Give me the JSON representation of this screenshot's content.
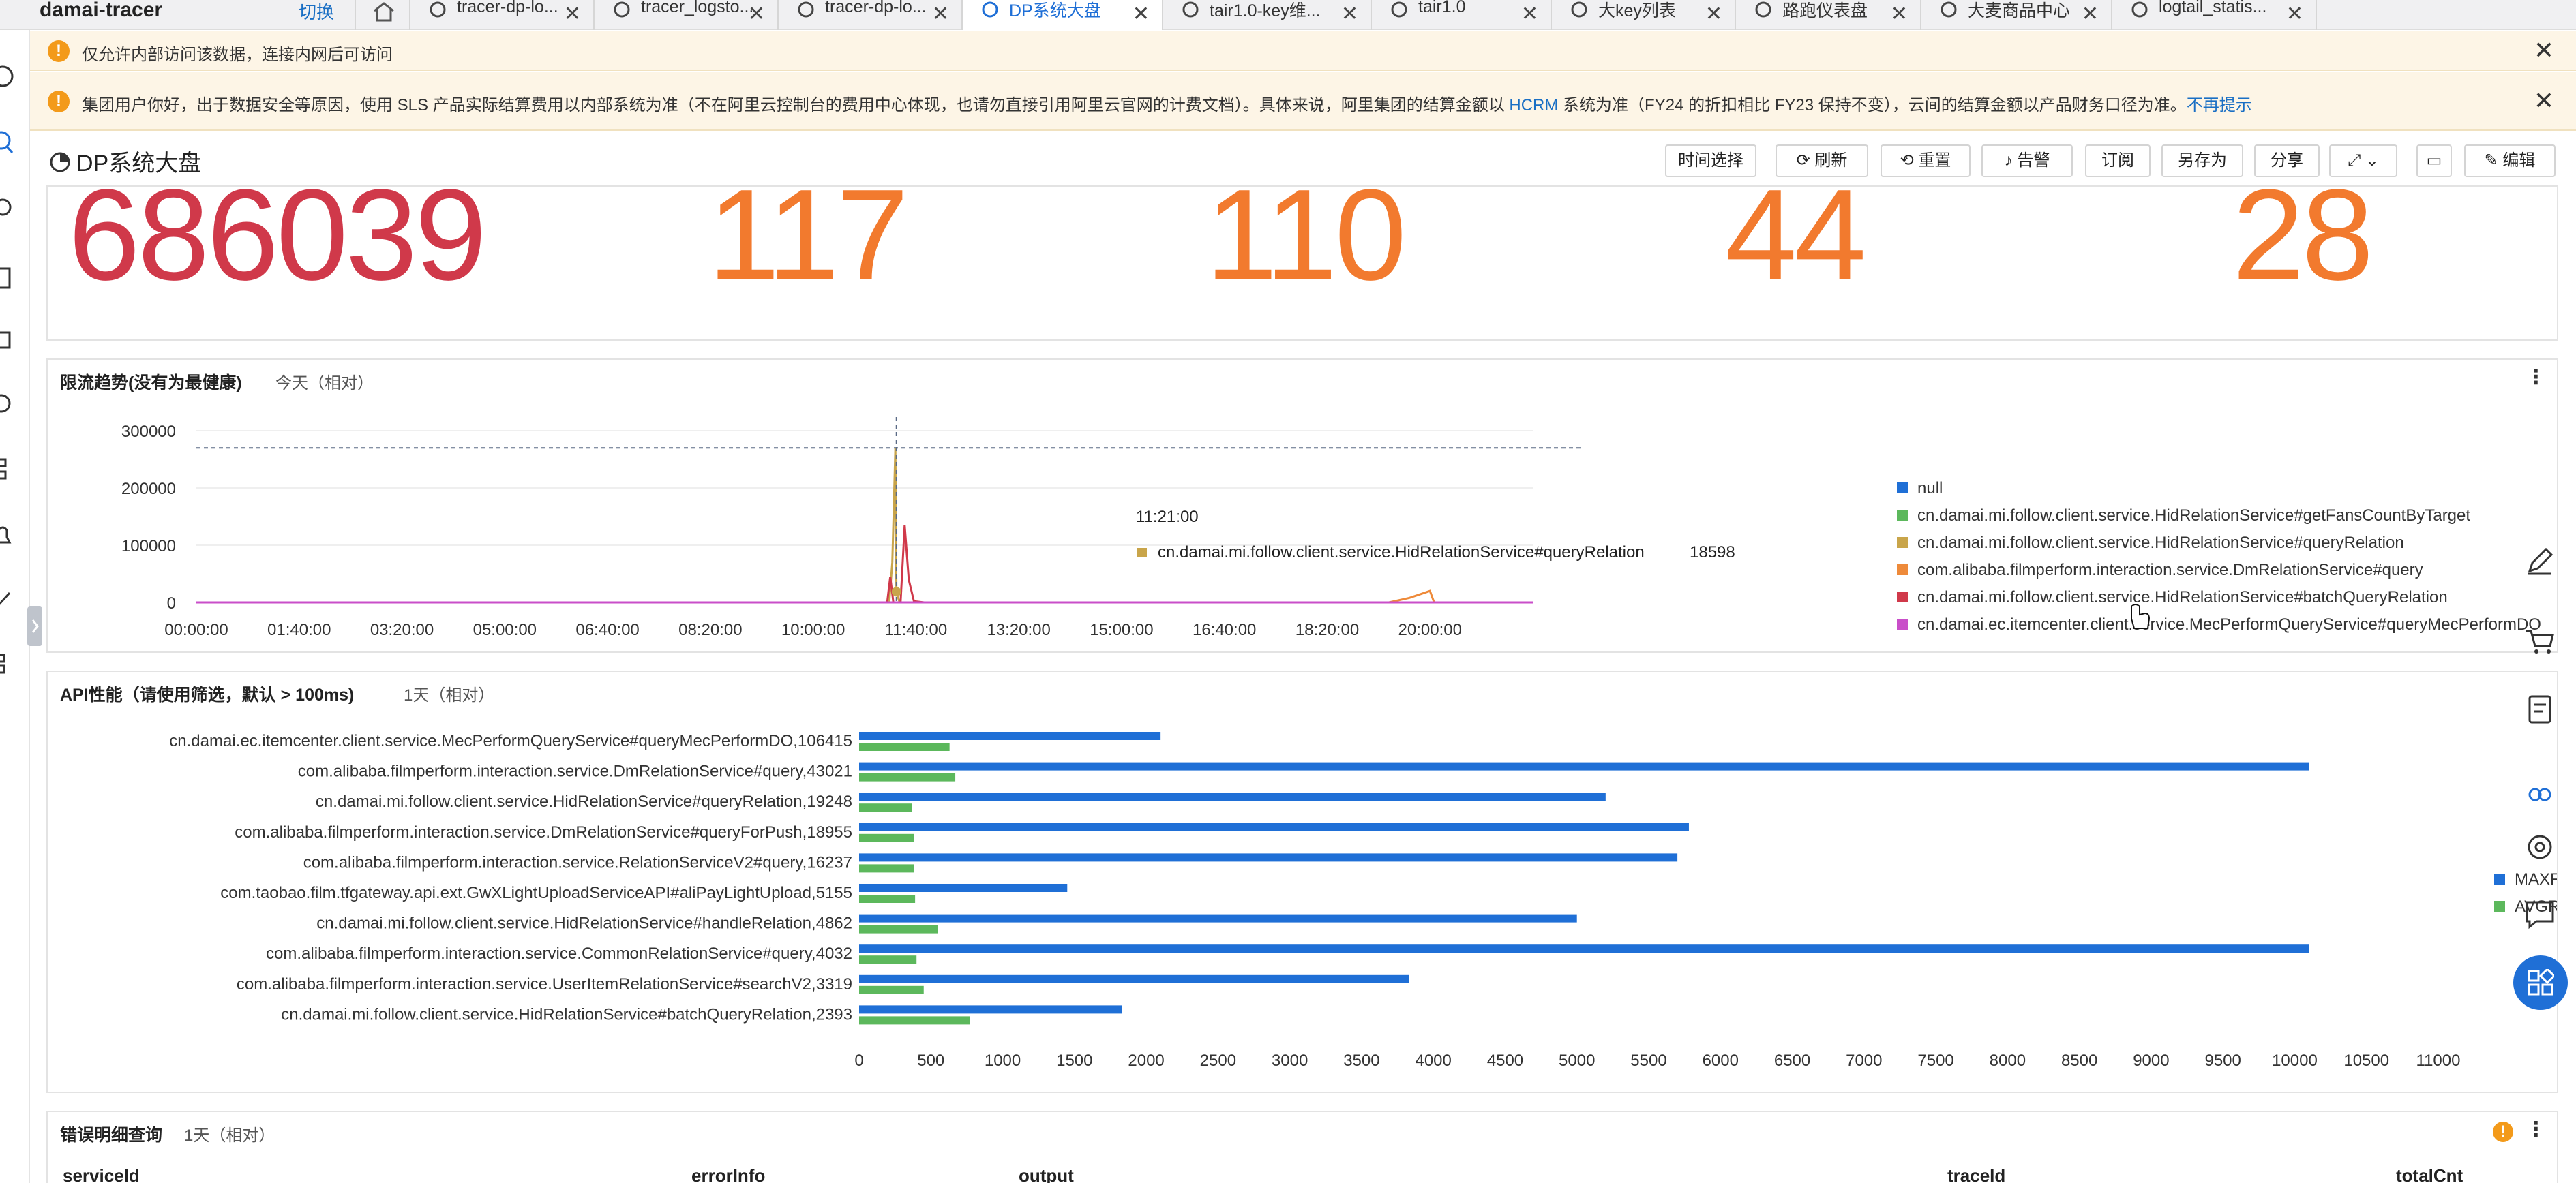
{
  "project": {
    "name": "damai-tracer",
    "switch_label": "切换"
  },
  "tabs": [
    {
      "label": "tracer-dp-lo...",
      "icon": "search-chart-icon"
    },
    {
      "label": "tracer_logsto...",
      "icon": "search-chart-icon"
    },
    {
      "label": "tracer-dp-lo...",
      "icon": "target-icon"
    },
    {
      "label": "DP系统大盘",
      "icon": "dashboard-icon",
      "active": true
    },
    {
      "label": "tair1.0-key维...",
      "icon": "dashboard-icon"
    },
    {
      "label": "tair1.0",
      "icon": "dashboard-icon"
    },
    {
      "label": "大key列表",
      "icon": "dashboard-icon"
    },
    {
      "label": "路跑仪表盘",
      "icon": "dashboard-icon"
    },
    {
      "label": "大麦商品中心",
      "icon": "dashboard-icon"
    },
    {
      "label": "logtail_statis...",
      "icon": "dashboard-icon"
    }
  ],
  "tab_close": "✕",
  "banners": {
    "internal": {
      "text": "仅允许内部访问该数据，连接内网后可访问"
    },
    "billing": {
      "text_a": "集团用户你好，出于数据安全等原因，使用 SLS 产品实际结算费用以内部系统为准（不在阿里云控制台的费用中心体现，也请勿直接引用阿里云官网的计费文档）。具体来说，阿里集团的结算金额以 ",
      "link_hcrm": "HCRM",
      "text_b": " 系统为准（FY24 的折扣相比 FY23 保持不变），云间的结算金额以产品财务口径为准。",
      "dismiss": "不再提示"
    }
  },
  "dashboard": {
    "title": "DP系统大盘"
  },
  "toolbar": {
    "time": "时间选择",
    "refresh": "刷新",
    "reset": "重置",
    "alert": "告警",
    "subscribe": "订阅",
    "save_as": "另存为",
    "share": "分享",
    "edit": "编辑"
  },
  "big_numbers": [
    "686039",
    "117",
    "110",
    "44",
    "28"
  ],
  "colors": {
    "red": "#d0394a",
    "orange": "#f27a2e",
    "blue": "#1f6fd6"
  },
  "panel_limit": {
    "title": "限流趋势(没有为最健康)",
    "range": "今天（相对）",
    "tooltip": {
      "time": "11:21:00",
      "series": "cn.damai.mi.follow.client.service.HidRelationService#queryRelation",
      "value": "18598"
    }
  },
  "panel_api": {
    "title": "API性能（请使用筛选，默认 > 100ms)",
    "range": "1天（相对）"
  },
  "panel_err": {
    "title": "错误明细查询",
    "range": "1天（相对）",
    "columns": [
      "serviceId",
      "errorInfo",
      "output",
      "traceId",
      "totalCnt"
    ]
  },
  "chart_data": [
    {
      "type": "line",
      "title": "限流趋势(没有为最健康)",
      "x_ticks": [
        "00:00:00",
        "01:40:00",
        "03:20:00",
        "05:00:00",
        "06:40:00",
        "08:20:00",
        "10:00:00",
        "11:40:00",
        "13:20:00",
        "15:00:00",
        "16:40:00",
        "18:20:00",
        "20:00:00"
      ],
      "y_ticks": [
        "0",
        "100000",
        "200000",
        "300000"
      ],
      "ylim": [
        0,
        300000
      ],
      "legend_position": "right",
      "series": [
        {
          "name": "null",
          "color": "#1f6fd6",
          "points": [
            [
              "00:00:00",
              0
            ],
            [
              "21:40:00",
              0
            ]
          ]
        },
        {
          "name": "cn.damai.mi.follow.client.service.HidRelationService#getFansCountByTarget",
          "color": "#5cb85c",
          "points": [
            [
              "00:00:00",
              0
            ],
            [
              "21:40:00",
              0
            ]
          ]
        },
        {
          "name": "cn.damai.mi.follow.client.service.HidRelationService#queryRelation",
          "color": "#c9a54a",
          "points": [
            [
              "11:00:00",
              0
            ],
            [
              "11:14:00",
              0
            ],
            [
              "11:17:00",
              70000
            ],
            [
              "11:20:00",
              270000
            ],
            [
              "11:21:00",
              18598
            ],
            [
              "11:24:00",
              0
            ],
            [
              "11:40:00",
              0
            ]
          ]
        },
        {
          "name": "com.alibaba.filmperform.interaction.service.DmRelationService#query",
          "color": "#ee8a3a",
          "points": [
            [
              "19:20:00",
              0
            ],
            [
              "19:40:00",
              8000
            ],
            [
              "20:00:00",
              20000
            ],
            [
              "20:04:00",
              0
            ]
          ]
        },
        {
          "name": "cn.damai.mi.follow.client.service.HidRelationService#batchQueryRelation",
          "color": "#d0394a",
          "points": [
            [
              "11:12:00",
              0
            ],
            [
              "11:15:00",
              45000
            ],
            [
              "11:18:00",
              0
            ],
            [
              "11:25:00",
              0
            ],
            [
              "11:29:00",
              135000
            ],
            [
              "11:33:00",
              40000
            ],
            [
              "11:38:00",
              2000
            ],
            [
              "11:48:00",
              0
            ]
          ]
        },
        {
          "name": "cn.damai.ec.itemcenter.client.service.MecPerformQueryService#queryMecPerformDO",
          "color": "#c94ec9",
          "points": [
            [
              "00:00:00",
              0
            ],
            [
              "21:40:00",
              0
            ]
          ]
        }
      ],
      "reference_line": 270000
    },
    {
      "type": "bar",
      "orientation": "horizontal",
      "title": "API性能（请使用筛选，默认 > 100ms)",
      "categories": [
        "cn.damai.ec.itemcenter.client.service.MecPerformQueryService#queryMecPerformDO,106415",
        "com.alibaba.filmperform.interaction.service.DmRelationService#query,43021",
        "cn.damai.mi.follow.client.service.HidRelationService#queryRelation,19248",
        "com.alibaba.filmperform.interaction.service.DmRelationService#queryForPush,18955",
        "com.alibaba.filmperform.interaction.service.RelationServiceV2#query,16237",
        "com.taobao.film.tfgateway.api.ext.GwXLightUploadServiceAPI#aliPayLightUpload,5155",
        "cn.damai.mi.follow.client.service.HidRelationService#handleRelation,4862",
        "com.alibaba.filmperform.interaction.service.CommonRelationService#query,4032",
        "com.alibaba.filmperform.interaction.service.UserItemRelationService#searchV2,3319",
        "cn.damai.mi.follow.client.service.HidRelationService#batchQueryRelation,2393"
      ],
      "series": [
        {
          "name": "MAXRT",
          "color": "#1f6fd6",
          "values": [
            2100,
            10100,
            5200,
            5780,
            5700,
            1450,
            5000,
            10100,
            3830,
            1830
          ]
        },
        {
          "name": "AVGRT",
          "color": "#5cb85c",
          "values": [
            630,
            670,
            370,
            380,
            380,
            390,
            550,
            400,
            450,
            770
          ]
        }
      ],
      "x_ticks": [
        0,
        500,
        1000,
        1500,
        2000,
        2500,
        3000,
        3500,
        4000,
        4500,
        5000,
        5500,
        6000,
        6500,
        7000,
        7500,
        8000,
        8500,
        9000,
        9500,
        10000,
        10500,
        11000
      ],
      "xlim": [
        0,
        11000
      ],
      "legend_position": "right",
      "legend_labels": [
        "MAXRT",
        "AVGR"
      ]
    }
  ]
}
